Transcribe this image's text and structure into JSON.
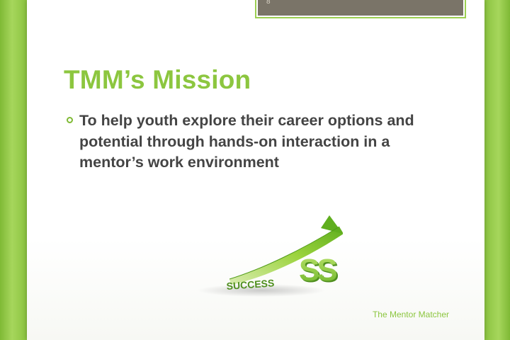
{
  "slide": {
    "number": "8",
    "title": "TMM’s Mission",
    "bullets": [
      "To help youth explore their career options and potential through hands-on interaction in a mentor’s work environment"
    ],
    "footer": "The Mentor Matcher"
  },
  "image": {
    "word": "SUCCESS",
    "icon": "rising-arrow-icon"
  },
  "colors": {
    "accent": "#8cc63f",
    "text": "#444444",
    "number_box": "#7a7468"
  }
}
